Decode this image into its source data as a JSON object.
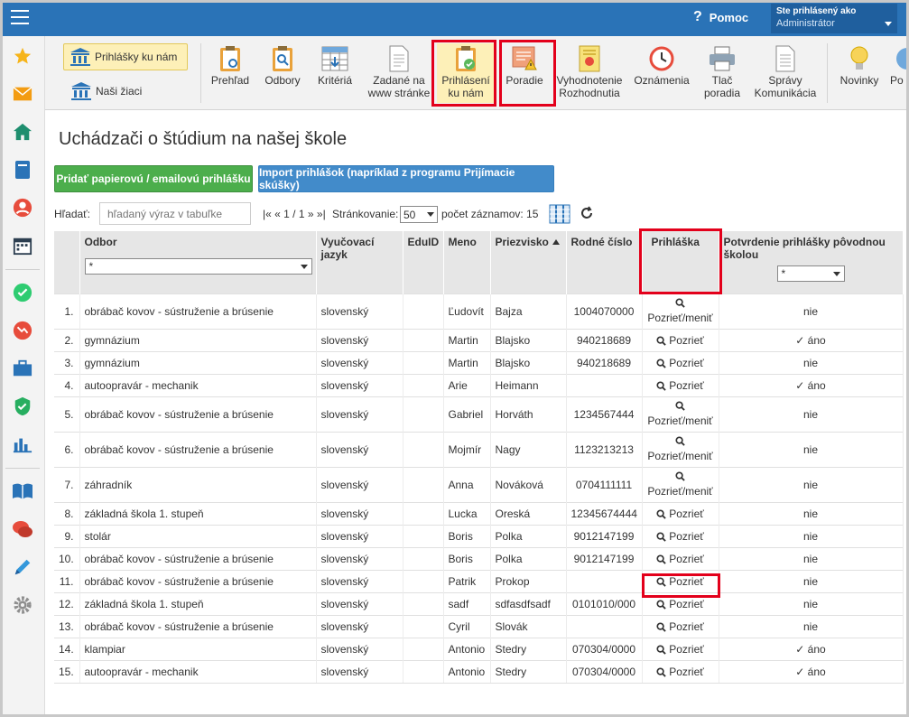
{
  "topbar": {
    "help_label": "Pomoc",
    "help_icon": "?",
    "user_line1": "Ste prihlásený ako",
    "user_line2": "Administrátor"
  },
  "sidebar_icons": [
    "star-icon",
    "envelope-icon",
    "home-icon",
    "book-icon",
    "person-icon",
    "calendar-icon",
    "check-icon",
    "chart-down-icon",
    "briefcase-icon",
    "shield-check-icon",
    "bar-chart-icon",
    "open-book-icon",
    "chat-icon",
    "pen-icon",
    "gear-icon"
  ],
  "ribbon": {
    "left_buttons": [
      {
        "label": "Prihlášky ku nám",
        "icon": "bank-people-icon",
        "active": true
      },
      {
        "label": "Naši žiaci",
        "icon": "bank-people-icon",
        "active": false
      }
    ],
    "items": [
      {
        "label1": "Prehľad",
        "label2": "",
        "icon": "clipboard-eye-icon"
      },
      {
        "label1": "Odbory",
        "label2": "",
        "icon": "clipboard-search-icon"
      },
      {
        "label1": "Kritériá",
        "label2": "",
        "icon": "table-icon"
      },
      {
        "label1": "Zadané na",
        "label2": "www stránke",
        "icon": "document-icon"
      },
      {
        "label1": "Prihlásení",
        "label2": "ku nám",
        "icon": "clipboard-check-icon"
      },
      {
        "label1": "Poradie",
        "label2": "",
        "icon": "warning-document-icon"
      },
      {
        "label1": "Vyhodnotenie",
        "label2": "Rozhodnutia",
        "icon": "certificate-icon"
      },
      {
        "label1": "Oznámenia",
        "label2": "",
        "icon": "clock-icon"
      },
      {
        "label1": "Tlač",
        "label2": "poradia",
        "icon": "printer-icon"
      },
      {
        "label1": "Správy",
        "label2": "Komunikácia",
        "icon": "document-lines-icon"
      },
      {
        "label1": "Novinky",
        "label2": "",
        "icon": "lightbulb-icon"
      },
      {
        "label1": "Po",
        "label2": "",
        "icon": "circle-icon"
      }
    ]
  },
  "page": {
    "title": "Uchádzači o štúdium na našej škole",
    "btn_add": "Pridať papierovú / emailovú prihlášku",
    "btn_import": "Import prihlášok (napríklad z programu Prijímacie skúšky)",
    "search_label": "Hľadať:",
    "search_placeholder": "hľadaný výraz v tabuľke",
    "pager_first": "|«",
    "pager_prev": "«",
    "pager_info": "1 / 1",
    "pager_next": "»",
    "pager_last": "»|",
    "paging_label": "Stránkovanie:",
    "paging_value": "50",
    "count_label": "počet záznamov: 15"
  },
  "table": {
    "headers": {
      "odbor": "Odbor",
      "jazyk": "Vyučovací jazyk",
      "eduid": "EduID",
      "meno": "Meno",
      "priezvisko": "Priezvisko",
      "rodne": "Rodné číslo",
      "prihlaska": "Prihláška",
      "potvrdenie": "Potvrdenie prihlášky pôvodnou školou"
    },
    "filter_odbor": "*",
    "filter_potvrdenie": "*",
    "rows": [
      {
        "n": "1.",
        "odbor": "obrábač kovov - sústruženie a brúsenie",
        "jazyk": "slovenský",
        "eduid": "",
        "meno": "Ľudovít",
        "priezvisko": "Bajza",
        "rodne": "1004070000",
        "link": "Pozrieť/meniť",
        "two": true,
        "potvrdenie": "nie"
      },
      {
        "n": "2.",
        "odbor": "gymnázium",
        "jazyk": "slovenský",
        "eduid": "",
        "meno": "Martin",
        "priezvisko": "Blajsko",
        "rodne": "940218689",
        "link": "Pozrieť",
        "two": false,
        "potvrdenie": "✓ áno"
      },
      {
        "n": "3.",
        "odbor": "gymnázium",
        "jazyk": "slovenský",
        "eduid": "",
        "meno": "Martin",
        "priezvisko": "Blajsko",
        "rodne": "940218689",
        "link": "Pozrieť",
        "two": false,
        "potvrdenie": "nie"
      },
      {
        "n": "4.",
        "odbor": "autoopravár - mechanik",
        "jazyk": "slovenský",
        "eduid": "",
        "meno": "Arie",
        "priezvisko": "Heimann",
        "rodne": "",
        "link": "Pozrieť",
        "two": false,
        "potvrdenie": "✓ áno"
      },
      {
        "n": "5.",
        "odbor": "obrábač kovov - sústruženie a brúsenie",
        "jazyk": "slovenský",
        "eduid": "",
        "meno": "Gabriel",
        "priezvisko": "Horváth",
        "rodne": "1234567444",
        "link": "Pozrieť/meniť",
        "two": true,
        "potvrdenie": "nie"
      },
      {
        "n": "6.",
        "odbor": "obrábač kovov - sústruženie a brúsenie",
        "jazyk": "slovenský",
        "eduid": "",
        "meno": "Mojmír",
        "priezvisko": "Nagy",
        "rodne": "1123213213",
        "link": "Pozrieť/meniť",
        "two": true,
        "potvrdenie": "nie"
      },
      {
        "n": "7.",
        "odbor": "záhradník",
        "jazyk": "slovenský",
        "eduid": "",
        "meno": "Anna",
        "priezvisko": "Nováková",
        "rodne": "0704111111",
        "link": "Pozrieť/meniť",
        "two": true,
        "potvrdenie": "nie"
      },
      {
        "n": "8.",
        "odbor": "základná škola 1. stupeň",
        "jazyk": "slovenský",
        "eduid": "",
        "meno": "Lucka",
        "priezvisko": "Oreská",
        "rodne": "12345674444",
        "link": "Pozrieť",
        "two": false,
        "potvrdenie": "nie"
      },
      {
        "n": "9.",
        "odbor": "stolár",
        "jazyk": "slovenský",
        "eduid": "",
        "meno": "Boris",
        "priezvisko": "Polka",
        "rodne": "9012147199",
        "link": "Pozrieť",
        "two": false,
        "potvrdenie": "nie"
      },
      {
        "n": "10.",
        "odbor": "obrábač kovov - sústruženie a brúsenie",
        "jazyk": "slovenský",
        "eduid": "",
        "meno": "Boris",
        "priezvisko": "Polka",
        "rodne": "9012147199",
        "link": "Pozrieť",
        "two": false,
        "potvrdenie": "nie"
      },
      {
        "n": "11.",
        "odbor": "obrábač kovov - sústruženie a brúsenie",
        "jazyk": "slovenský",
        "eduid": "",
        "meno": "Patrik",
        "priezvisko": "Prokop",
        "rodne": "",
        "link": "Pozrieť",
        "two": false,
        "potvrdenie": "nie"
      },
      {
        "n": "12.",
        "odbor": "základná škola 1. stupeň",
        "jazyk": "slovenský",
        "eduid": "",
        "meno": "sadf",
        "priezvisko": "sdfasdfsadf",
        "rodne": "0101010/000",
        "link": "Pozrieť",
        "two": false,
        "potvrdenie": "nie"
      },
      {
        "n": "13.",
        "odbor": "obrábač kovov - sústruženie a brúsenie",
        "jazyk": "slovenský",
        "eduid": "",
        "meno": "Cyril",
        "priezvisko": "Slovák",
        "rodne": "",
        "link": "Pozrieť",
        "two": false,
        "potvrdenie": "nie"
      },
      {
        "n": "14.",
        "odbor": "klampiar",
        "jazyk": "slovenský",
        "eduid": "",
        "meno": "Antonio",
        "priezvisko": "Stedry",
        "rodne": "070304/0000",
        "link": "Pozrieť",
        "two": false,
        "potvrdenie": "✓ áno"
      },
      {
        "n": "15.",
        "odbor": "autoopravár - mechanik",
        "jazyk": "slovenský",
        "eduid": "",
        "meno": "Antonio",
        "priezvisko": "Stedry",
        "rodne": "070304/0000",
        "link": "Pozrieť",
        "two": false,
        "potvrdenie": "✓ áno"
      }
    ]
  },
  "colors": {
    "topbar": "#2a73b7",
    "highlight": "#e3001b",
    "green_button": "#4cae4c",
    "blue_button": "#428bca"
  }
}
